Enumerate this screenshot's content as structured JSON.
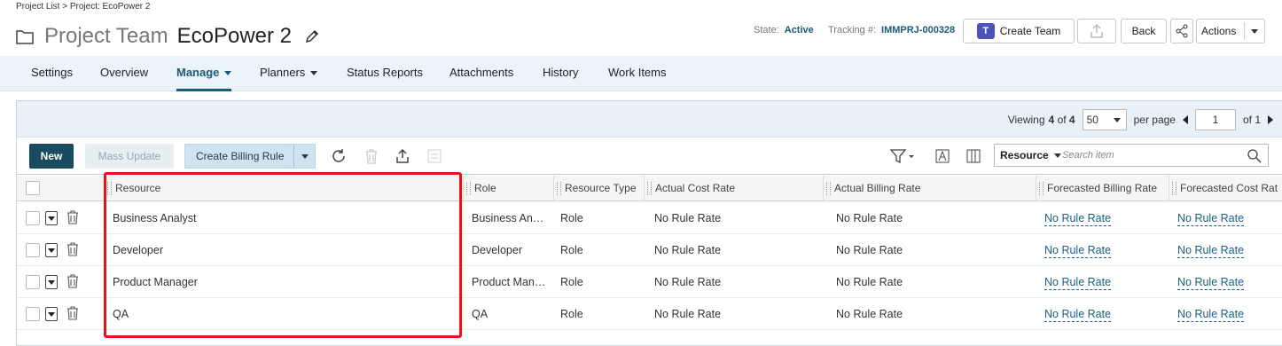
{
  "breadcrumb": "Project List > Project: EcoPower 2",
  "header": {
    "kind": "Project Team",
    "name": "EcoPower 2",
    "state_label": "State:",
    "state_value": "Active",
    "tracking_label": "Tracking #:",
    "tracking_value": "IMMPRJ-000328",
    "create_team_label": "Create Team",
    "back_label": "Back",
    "actions_label": "Actions"
  },
  "tabs": [
    {
      "label": "Settings"
    },
    {
      "label": "Overview"
    },
    {
      "label": "Manage",
      "active": true
    },
    {
      "label": "Planners"
    },
    {
      "label": "Status Reports"
    },
    {
      "label": "Attachments"
    },
    {
      "label": "History"
    },
    {
      "label": "Work Items"
    }
  ],
  "pager": {
    "viewing_label": "Viewing",
    "shown": "4",
    "of_label": "of",
    "total": "4",
    "per_page_value": "50",
    "per_page_label": "per page",
    "page": "1",
    "of_pages": "of 1"
  },
  "toolbar": {
    "new_label": "New",
    "mass_update_label": "Mass Update",
    "billing_label": "Create Billing Rule",
    "search_scope": "Resource",
    "search_placeholder": "Search item"
  },
  "columns": [
    "Resource",
    "Role",
    "Resource Type",
    "Actual Cost Rate",
    "Actual Billing Rate",
    "Forecasted Billing Rate",
    "Forecasted Cost Rat"
  ],
  "rows": [
    {
      "resource": "Business Analyst",
      "role": "Business An…",
      "type": "Role",
      "acr": "No Rule Rate",
      "abr": "No Rule Rate",
      "fbr": "No Rule Rate",
      "fcr": "No Rule Rate"
    },
    {
      "resource": "Developer",
      "role": "Developer",
      "type": "Role",
      "acr": "No Rule Rate",
      "abr": "No Rule Rate",
      "fbr": "No Rule Rate",
      "fcr": "No Rule Rate"
    },
    {
      "resource": "Product Manager",
      "role": "Product Man…",
      "type": "Role",
      "acr": "No Rule Rate",
      "abr": "No Rule Rate",
      "fbr": "No Rule Rate",
      "fcr": "No Rule Rate"
    },
    {
      "resource": "QA",
      "role": "QA",
      "type": "Role",
      "acr": "No Rule Rate",
      "abr": "No Rule Rate",
      "fbr": "No Rule Rate",
      "fcr": "No Rule Rate"
    }
  ],
  "colors": {
    "accent": "#1d5a7a",
    "highlight": "#e8121b",
    "new_button": "#184a60"
  }
}
